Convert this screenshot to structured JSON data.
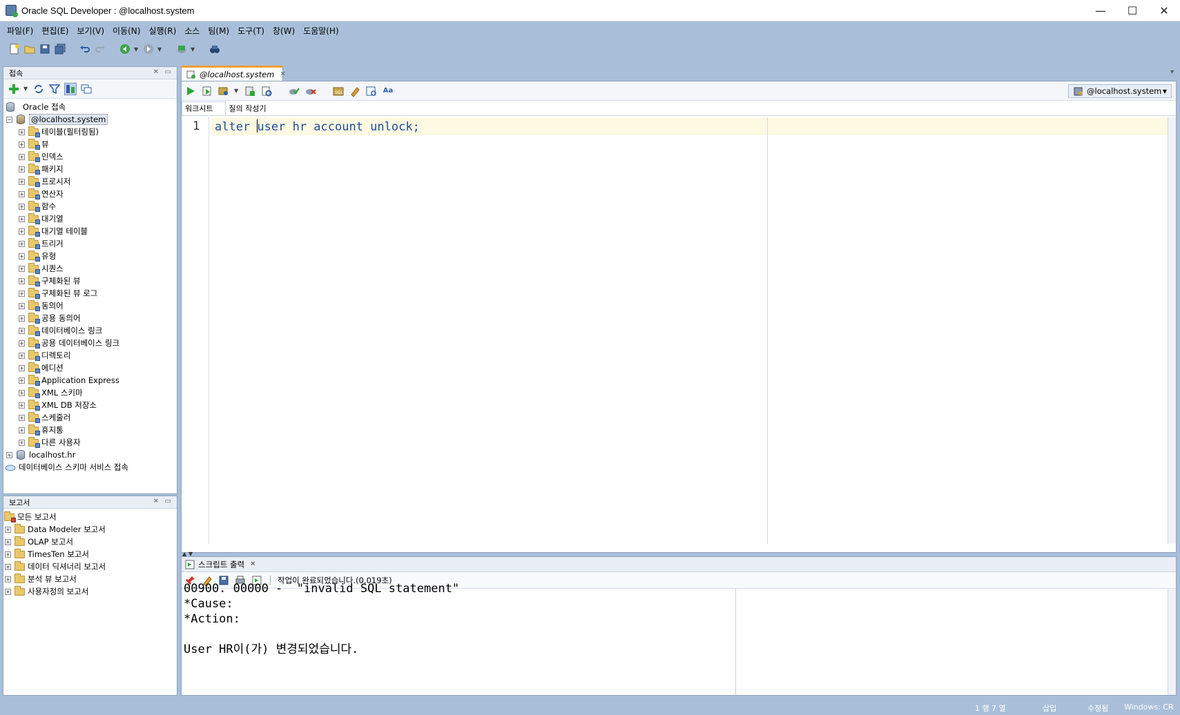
{
  "window": {
    "title": "Oracle SQL Developer : @localhost.system"
  },
  "menu": [
    "파일(F)",
    "편집(E)",
    "보기(V)",
    "이동(N)",
    "실행(R)",
    "소스",
    "팀(M)",
    "도구(T)",
    "창(W)",
    "도움말(H)"
  ],
  "connections_panel": {
    "title": "접속",
    "root_label": "Oracle 접속",
    "active_connection": "@localhost.system",
    "object_folders": [
      "테이블(필터링됨)",
      "뷰",
      "인덱스",
      "패키지",
      "프로시저",
      "연산자",
      "함수",
      "대기열",
      "대기열 테이블",
      "트리거",
      "유형",
      "시퀀스",
      "구체화된 뷰",
      "구체화된 뷰 로그",
      "동의어",
      "공용 동의어",
      "데이터베이스 링크",
      "공용 데이터베이스 링크",
      "디렉토리",
      "에디션",
      "Application Express",
      "XML 스키마",
      "XML DB 저장소",
      "스케줄러",
      "휴지통",
      "다른 사용자"
    ],
    "other_connection": "localhost.hr",
    "schema_service": "데이터베이스 스키마 서비스 접속"
  },
  "reports_panel": {
    "title": "보고서",
    "root_label": "모든 보고서",
    "items": [
      "Data Modeler 보고서",
      "OLAP 보고서",
      "TimesTen 보고서",
      "데이터 딕셔너리 보고서",
      "분석 뷰 보고서",
      "사용자정의 보고서"
    ]
  },
  "editor": {
    "tab_label": "@localhost.system",
    "connection_selector": "@localhost.system",
    "subtabs": [
      "워크시트",
      "질의 작성기"
    ],
    "line_number": "1",
    "code_before_caret": "alter ",
    "code_after_caret": "user hr account unlock;"
  },
  "output": {
    "tab_label": "스크립트 출력",
    "status": "작업이 완료되었습니다.(0.019초)",
    "lines": [
      "00900. 00000 -  \"invalid SQL statement\"",
      "*Cause:",
      "*Action:",
      "",
      "User HR이(가) 변경되었습니다."
    ]
  },
  "statusbar": {
    "position": "1 행 7 열",
    "insert_mode": "삽입",
    "modified": "수정됨",
    "line_endings": "Windows: CR"
  },
  "colors": {
    "frame_blue": "#a9bfd9",
    "tab_accent": "#f0a030",
    "code_blue": "#1e4f9e",
    "line_highlight": "#fdf9e2"
  }
}
